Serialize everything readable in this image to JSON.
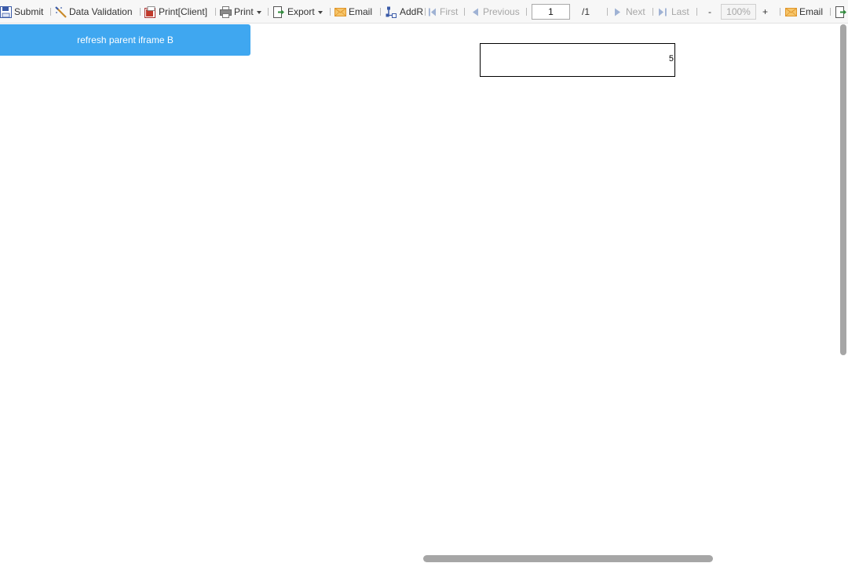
{
  "toolbar": {
    "submit": "Submit",
    "data_validation": "Data Validation",
    "print_client": "Print[Client]",
    "print": "Print",
    "export": "Export",
    "email": "Email",
    "addr": "AddR",
    "first": "First",
    "previous": "Previous",
    "page_current": "1",
    "page_total": "/1",
    "next": "Next",
    "last": "Last",
    "zoom_out": "-",
    "zoom_value": "100%",
    "zoom_in": "+",
    "email2": "Email"
  },
  "main": {
    "refresh_button": "refresh parent iframe B",
    "cell_value": "5"
  },
  "icons": {
    "submit": "save-icon",
    "data_validation": "wand-icon",
    "print_client": "pdf-print-icon",
    "print": "printer-icon",
    "export": "export-icon",
    "email": "envelope-icon",
    "addr": "add-row-icon",
    "first": "first-page-icon",
    "previous": "previous-page-icon",
    "next": "next-page-icon",
    "last": "last-page-icon",
    "email2": "envelope-icon",
    "export2": "export-icon"
  },
  "colors": {
    "refresh_button_bg": "#3fa7f0",
    "toolbar_bg": "#f7f7f7",
    "disabled_text": "#a7a7a7",
    "icon_blue": "#3b5ba8",
    "icon_orange": "#f0a030"
  }
}
